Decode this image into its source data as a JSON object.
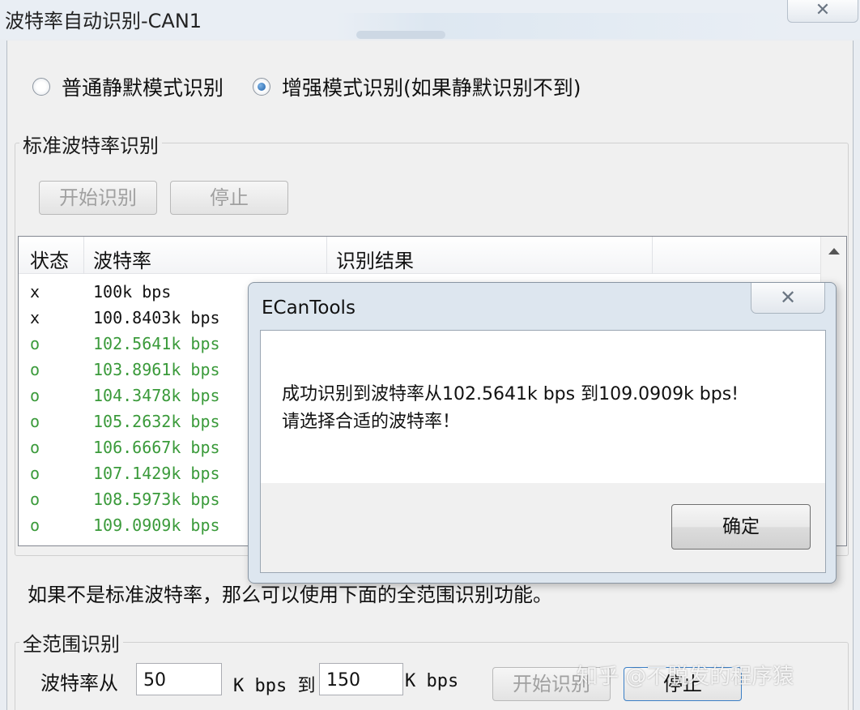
{
  "window": {
    "title": "波特率自动识别-CAN1",
    "close_glyph": "✕"
  },
  "mode": {
    "options": [
      {
        "label": "普通静默模式识别",
        "selected": false
      },
      {
        "label": "增强模式识别(如果静默识别不到)",
        "selected": true
      }
    ]
  },
  "standard": {
    "group_label": "标准波特率识别",
    "start_label": "开始识别",
    "stop_label": "停止",
    "columns": [
      "状态",
      "波特率",
      "识别结果"
    ],
    "rows": [
      {
        "status": "x",
        "baud": "100k bps"
      },
      {
        "status": "x",
        "baud": "100.8403k bps"
      },
      {
        "status": "o",
        "baud": "102.5641k bps"
      },
      {
        "status": "o",
        "baud": "103.8961k bps"
      },
      {
        "status": "o",
        "baud": "104.3478k bps"
      },
      {
        "status": "o",
        "baud": "105.2632k bps"
      },
      {
        "status": "o",
        "baud": "106.6667k bps"
      },
      {
        "status": "o",
        "baud": "107.1429k bps"
      },
      {
        "status": "o",
        "baud": "108.5973k bps"
      },
      {
        "status": "o",
        "baud": "109.0909k bps"
      }
    ]
  },
  "hint": "如果不是标准波特率，那么可以使用下面的全范围识别功能。",
  "full_range": {
    "group_label": "全范围识别",
    "from_label": "波特率从",
    "from_value": "50",
    "unit_to": "K bps 到",
    "to_value": "150",
    "unit": "K bps",
    "start_label": "开始识别",
    "stop_label": "停止"
  },
  "dialog": {
    "title": "ECanTools",
    "close_glyph": "✕",
    "line1": "成功识别到波特率从102.5641k bps 到109.0909k bps!",
    "line2": "请选择合适的波特率！",
    "ok_label": "确定"
  },
  "watermark": "知乎 @不脱发的程序猿",
  "colors": {
    "ok_status": "#3a9a3a",
    "fail_status": "#111111",
    "radio_selected": "#1d5fa8"
  }
}
